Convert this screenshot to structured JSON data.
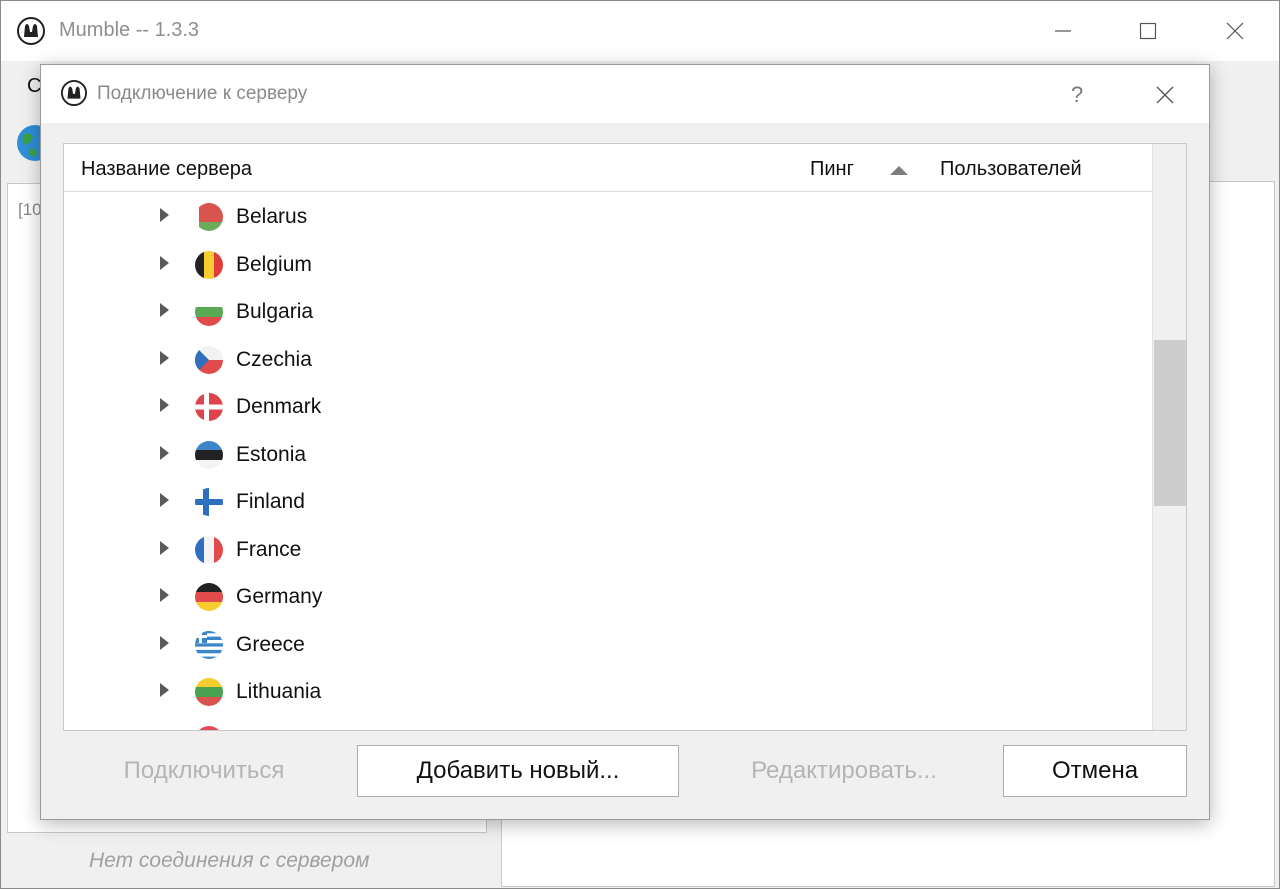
{
  "main_window": {
    "title": "Mumble -- 1.3.3",
    "menu_partial": "С",
    "log_partial": "[10",
    "status": "Нет соединения с сервером"
  },
  "dialog": {
    "title": "Подключение к серверу",
    "help_label": "?",
    "columns": {
      "name": "Название сервера",
      "ping": "Пинг",
      "users": "Пользователей"
    },
    "sort": {
      "column": "ping",
      "direction": "ascending"
    },
    "countries": [
      {
        "name": "Belarus",
        "flag": "flag-belarus-icon"
      },
      {
        "name": "Belgium",
        "flag": "flag-belgium-icon"
      },
      {
        "name": "Bulgaria",
        "flag": "flag-bulgaria-icon"
      },
      {
        "name": "Czechia",
        "flag": "flag-czechia-icon"
      },
      {
        "name": "Denmark",
        "flag": "flag-denmark-icon"
      },
      {
        "name": "Estonia",
        "flag": "flag-estonia-icon"
      },
      {
        "name": "Finland",
        "flag": "flag-finland-icon"
      },
      {
        "name": "France",
        "flag": "flag-france-icon"
      },
      {
        "name": "Germany",
        "flag": "flag-germany-icon"
      },
      {
        "name": "Greece",
        "flag": "flag-greece-icon"
      },
      {
        "name": "Lithuania",
        "flag": "flag-lithuania-icon"
      }
    ],
    "buttons": {
      "connect": "Подключиться",
      "add_new": "Добавить новый...",
      "edit": "Редактировать...",
      "cancel": "Отмена"
    }
  },
  "colors": {
    "disabled_text": "#b4b4b4",
    "title_text": "#8a8a8a"
  }
}
